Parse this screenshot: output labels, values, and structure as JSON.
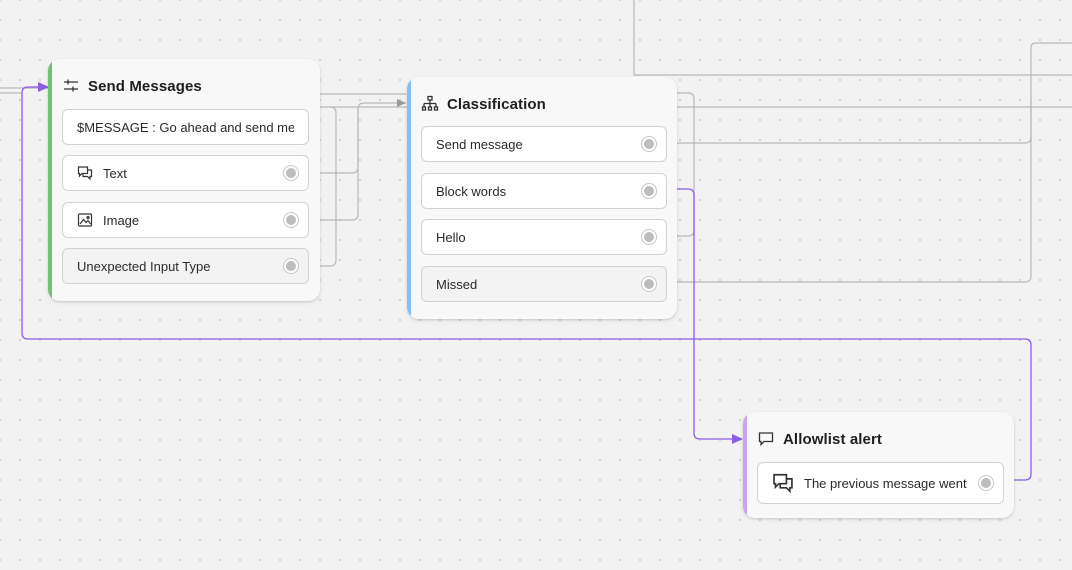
{
  "colors": {
    "edge_gray": "#b8b8b8",
    "edge_purple": "#8b5ce6",
    "accent_green": "#6cc46c",
    "accent_blue": "#86bff5",
    "accent_purple": "#c7a5f0"
  },
  "nodes": {
    "send_messages": {
      "title": "Send Messages",
      "icon": "sliders-icon",
      "message_field": "$MESSAGE : Go ahead and send me the",
      "items": [
        {
          "label": "Text",
          "icon": "chat-bubbles-icon"
        },
        {
          "label": "Image",
          "icon": "image-icon"
        },
        {
          "label": "Unexpected Input Type"
        }
      ]
    },
    "classification": {
      "title": "Classification",
      "icon": "hierarchy-icon",
      "items": [
        {
          "label": "Send message"
        },
        {
          "label": "Block words"
        },
        {
          "label": "Hello"
        },
        {
          "label": "Missed"
        }
      ]
    },
    "allowlist_alert": {
      "title": "Allowlist alert",
      "icon": "chat-bubble-icon",
      "items": [
        {
          "label": "The previous message went",
          "icon": "chat-bubbles-icon"
        }
      ]
    }
  }
}
